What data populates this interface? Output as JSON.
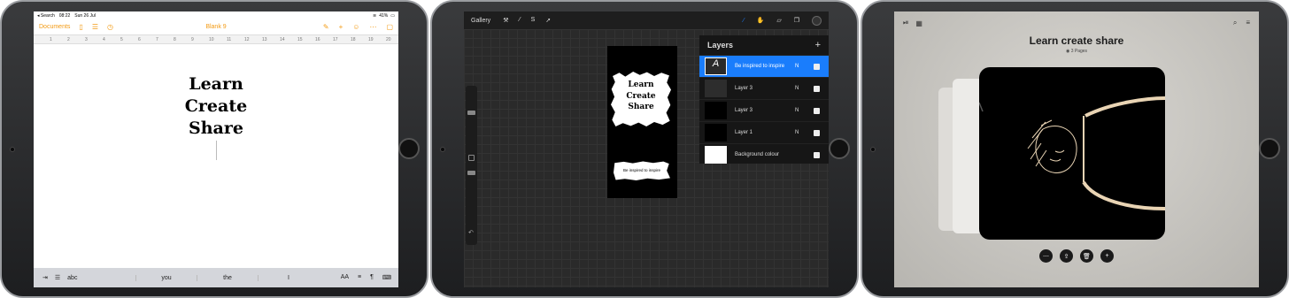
{
  "ipad1": {
    "status": {
      "back": "◂ Search",
      "time": "08:22",
      "date": "Sun 26 Jul",
      "battery": "41%"
    },
    "toolbar": {
      "documents": "Documents",
      "title": "Blank 9"
    },
    "ruler_marks": [
      "1",
      "2",
      "3",
      "4",
      "5",
      "6",
      "7",
      "8",
      "9",
      "10",
      "11",
      "12",
      "13",
      "14",
      "15",
      "16",
      "17",
      "18",
      "19",
      "20"
    ],
    "doc_lines": [
      "Learn",
      "Create",
      "Share"
    ],
    "keyboard": {
      "abc": "abc",
      "suggestions": [
        "you",
        "the",
        "I"
      ],
      "aa": "AA"
    }
  },
  "ipad2": {
    "gallery": "Gallery",
    "canvas_lines": [
      "Learn",
      "Create",
      "Share"
    ],
    "canvas_caption": "Be inspired to inspire",
    "layers_title": "Layers",
    "layers": [
      {
        "name": "Be inspired to inspire",
        "mode": "N",
        "active": true
      },
      {
        "name": "Layer 3",
        "mode": "N",
        "active": false
      },
      {
        "name": "Layer 3",
        "mode": "N",
        "active": false
      },
      {
        "name": "Layer 1",
        "mode": "N",
        "active": false
      },
      {
        "name": "Background colour",
        "mode": "",
        "active": false
      }
    ]
  },
  "ipad3": {
    "title": "Learn create share",
    "pages": "3 Pages"
  },
  "colors": {
    "accent_pages": "#f39a13",
    "accent_procreate": "#1a7dfc"
  }
}
